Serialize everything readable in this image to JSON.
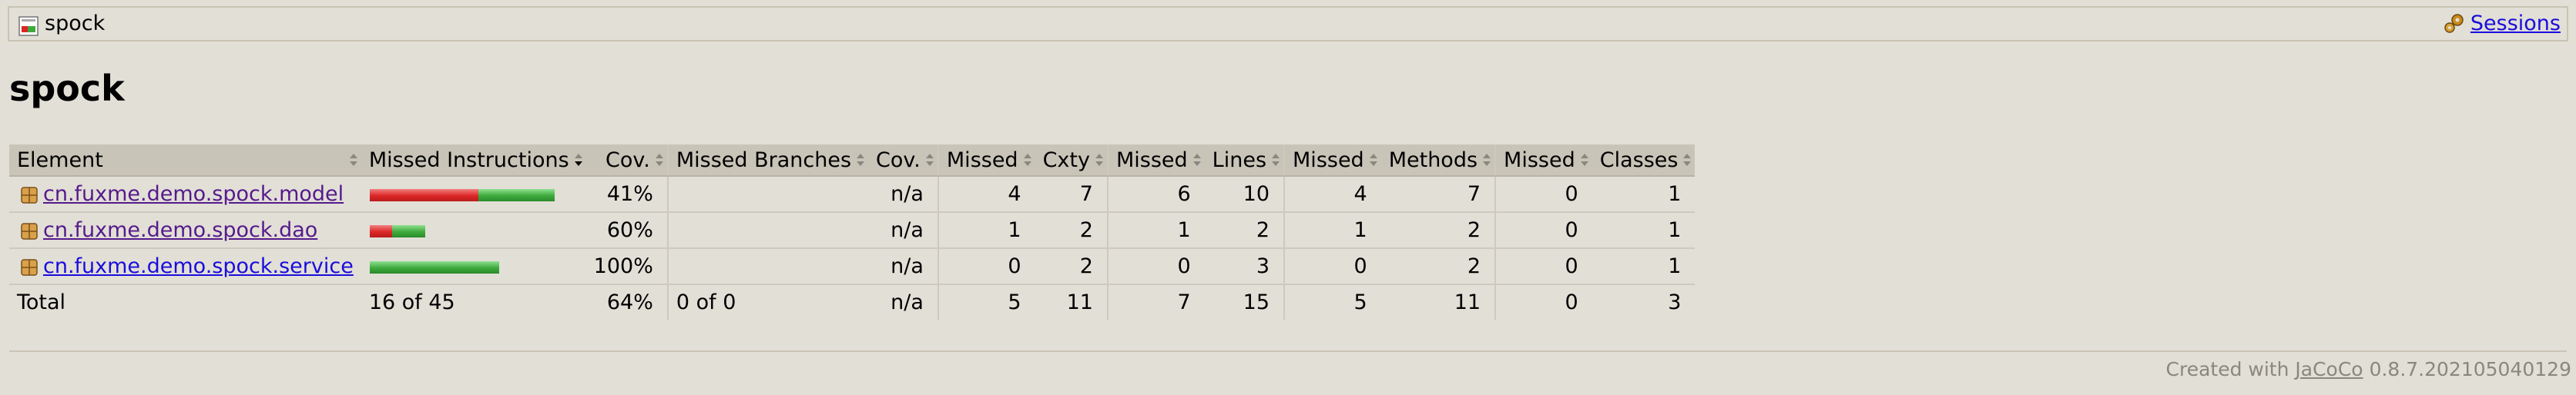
{
  "breadcrumb": {
    "report_name": "spock",
    "sessions_label": "Sessions"
  },
  "page": {
    "title": "spock"
  },
  "table": {
    "headers": {
      "element": "Element",
      "missed_instructions": "Missed Instructions",
      "instr_cov": "Cov.",
      "missed_branches": "Missed Branches",
      "branch_cov": "Cov.",
      "missed_cxty": "Missed",
      "cxty": "Cxty",
      "missed_lines": "Missed",
      "lines": "Lines",
      "missed_methods": "Missed",
      "methods": "Methods",
      "missed_classes": "Missed",
      "classes": "Classes"
    },
    "rows": [
      {
        "name": "cn.fuxme.demo.spock.model",
        "instr_missed_fraction": 0.59,
        "instr_cov": "41%",
        "branch_cov": "n/a",
        "missed_cxty": "4",
        "cxty": "7",
        "missed_lines": "6",
        "lines": "10",
        "missed_methods": "4",
        "methods": "7",
        "missed_classes": "0",
        "classes": "1"
      },
      {
        "name": "cn.fuxme.demo.spock.dao",
        "instr_missed_fraction": 0.4,
        "instr_cov": "60%",
        "branch_cov": "n/a",
        "missed_cxty": "1",
        "cxty": "2",
        "missed_lines": "1",
        "lines": "2",
        "missed_methods": "1",
        "methods": "2",
        "missed_classes": "0",
        "classes": "1"
      },
      {
        "name": "cn.fuxme.demo.spock.service",
        "instr_missed_fraction": 0.0,
        "instr_cov": "100%",
        "branch_cov": "n/a",
        "missed_cxty": "0",
        "cxty": "2",
        "missed_lines": "0",
        "lines": "3",
        "missed_methods": "0",
        "methods": "2",
        "missed_classes": "0",
        "classes": "1"
      }
    ],
    "total": {
      "label": "Total",
      "missed_instructions": "16 of 45",
      "instr_cov": "64%",
      "missed_branches": "0 of 0",
      "branch_cov": "n/a",
      "missed_cxty": "5",
      "cxty": "11",
      "missed_lines": "7",
      "lines": "15",
      "missed_methods": "5",
      "methods": "11",
      "missed_classes": "0",
      "classes": "3"
    }
  },
  "footer": {
    "created_with": "Created with",
    "tool_name": "JaCoCo",
    "version": "0.8.7.202105040129"
  },
  "colors": {
    "background": "#e2dfd7",
    "header": "#c8c4b8",
    "bar_missed": "#dc2626",
    "bar_covered": "#3daa3d"
  },
  "icons": {
    "report": "report-icon",
    "sessions": "sessions-icon",
    "package": "package-icon",
    "sort": "sort-icon"
  }
}
